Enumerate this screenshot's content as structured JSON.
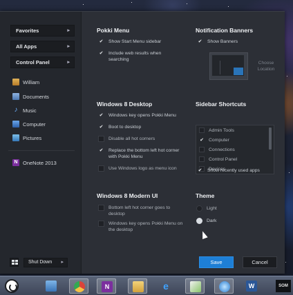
{
  "sidebar": {
    "buttons": [
      {
        "label": "Favorites",
        "chevron": "▸"
      },
      {
        "label": "All Apps",
        "chevron": "▸"
      },
      {
        "label": "Control Panel",
        "chevron": "▸"
      }
    ],
    "links": [
      {
        "label": "William",
        "icon": "user-folder-icon"
      },
      {
        "label": "Documents",
        "icon": "documents-icon"
      },
      {
        "label": "Music",
        "icon": "music-icon"
      },
      {
        "label": "Computer",
        "icon": "computer-icon"
      },
      {
        "label": "Pictures",
        "icon": "pictures-icon"
      }
    ],
    "pinned": [
      {
        "label": "OneNote 2013",
        "icon": "onenote-icon"
      }
    ],
    "shutdown_label": "Shut Down",
    "shutdown_chevron": "▸"
  },
  "pokki_menu": {
    "heading": "Pokki Menu",
    "options": [
      {
        "label": "Show Start Menu sidebar",
        "checked": true
      },
      {
        "label": "Include web results when searching",
        "checked": true
      }
    ]
  },
  "notification_banners": {
    "heading": "Notification Banners",
    "options": [
      {
        "label": "Show Banners",
        "checked": true
      }
    ],
    "choose_location": "Choose Location"
  },
  "windows8_desktop": {
    "heading": "Windows 8 Desktop",
    "options": [
      {
        "label": "Windows key opens Pokki Menu",
        "checked": true
      },
      {
        "label": "Boot to desktop",
        "checked": true
      },
      {
        "label": "Disable all hot corners",
        "checked": false
      },
      {
        "label": "Replace the bottom left hot corner with Pokki Menu",
        "checked": true
      },
      {
        "label": "Use Windows logo as menu icon",
        "checked": false
      }
    ]
  },
  "sidebar_shortcuts": {
    "heading": "Sidebar Shortcuts",
    "items": [
      {
        "label": "Admin Tools",
        "checked": false
      },
      {
        "label": "Computer",
        "checked": true
      },
      {
        "label": "Connections",
        "checked": false
      },
      {
        "label": "Control Panel",
        "checked": false
      },
      {
        "label": "Devices",
        "checked": false
      }
    ],
    "show_recent": {
      "label": "Show recently used apps",
      "checked": true
    }
  },
  "windows8_modern": {
    "heading": "Windows 8 Modern UI",
    "options": [
      {
        "label": "Bottom left hot corner goes to desktop",
        "checked": false
      },
      {
        "label": "Windows key opens Pokki Menu on the desktop",
        "checked": false
      }
    ]
  },
  "theme": {
    "heading": "Theme",
    "options": [
      {
        "label": "Light",
        "selected": false
      },
      {
        "label": "Dark",
        "selected": true
      }
    ]
  },
  "actions": {
    "save": "Save",
    "cancel": "Cancel"
  },
  "taskbar": {
    "apps": [
      {
        "name": "file-explorer-icon"
      },
      {
        "name": "chrome-icon"
      },
      {
        "name": "onenote-icon",
        "glyph": "N"
      },
      {
        "name": "folder-icon"
      },
      {
        "name": "internet-explorer-icon",
        "glyph": "e"
      },
      {
        "name": "paint-icon"
      },
      {
        "name": "itunes-icon"
      },
      {
        "name": "word-icon",
        "glyph": "W"
      }
    ],
    "clock_label": "SOM"
  },
  "colors": {
    "accent": "#1e7fd6",
    "menu_bg": "#2c2f36",
    "sidebar_bg": "#24272d"
  }
}
